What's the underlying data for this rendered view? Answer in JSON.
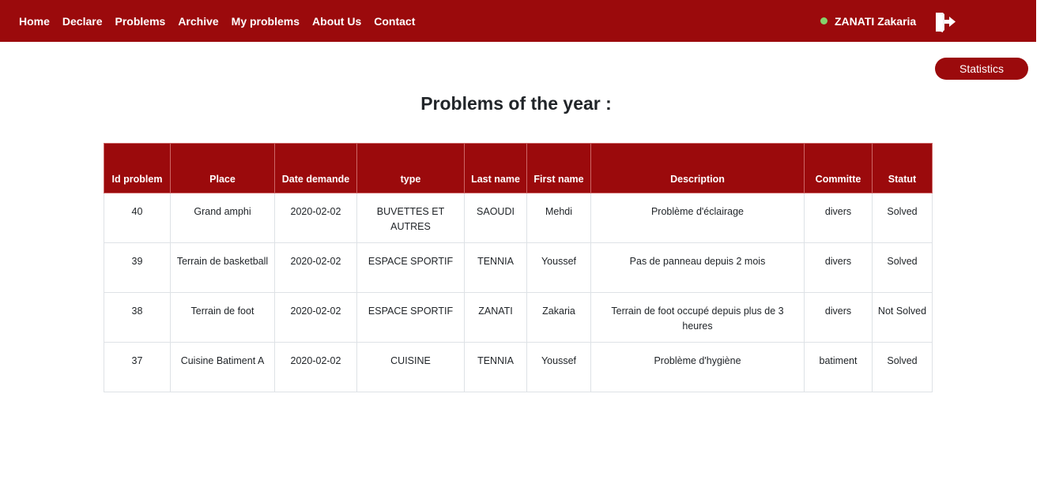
{
  "nav": {
    "links": [
      "Home",
      "Declare",
      "Problems",
      "Archive",
      "My problems",
      "About Us",
      "Contact"
    ],
    "user_name": "ZANATI Zakaria",
    "status_color": "#86d26b",
    "logout_icon": "logout-icon"
  },
  "brand_color": "#9b0a0c",
  "statistics_button": "Statistics",
  "page_title": "Problems of the year :",
  "table": {
    "headers": [
      "Id problem",
      "Place",
      "Date demande",
      "type",
      "Last name",
      "First name",
      "Description",
      "Committe",
      "Statut"
    ],
    "rows": [
      [
        "40",
        "Grand amphi",
        "2020-02-02",
        "BUVETTES ET AUTRES",
        "SAOUDI",
        "Mehdi",
        "Problème d'éclairage",
        "divers",
        "Solved"
      ],
      [
        "39",
        "Terrain de basketball",
        "2020-02-02",
        "ESPACE SPORTIF",
        "TENNIA",
        "Youssef",
        "Pas de panneau depuis 2 mois",
        "divers",
        "Solved"
      ],
      [
        "38",
        "Terrain de foot",
        "2020-02-02",
        "ESPACE SPORTIF",
        "ZANATI",
        "Zakaria",
        "Terrain de foot occupé depuis plus de 3 heures",
        "divers",
        "Not Solved"
      ],
      [
        "37",
        "Cuisine Batiment A",
        "2020-02-02",
        "CUISINE",
        "TENNIA",
        "Youssef",
        "Problème d'hygiène",
        "batiment",
        "Solved"
      ]
    ]
  }
}
